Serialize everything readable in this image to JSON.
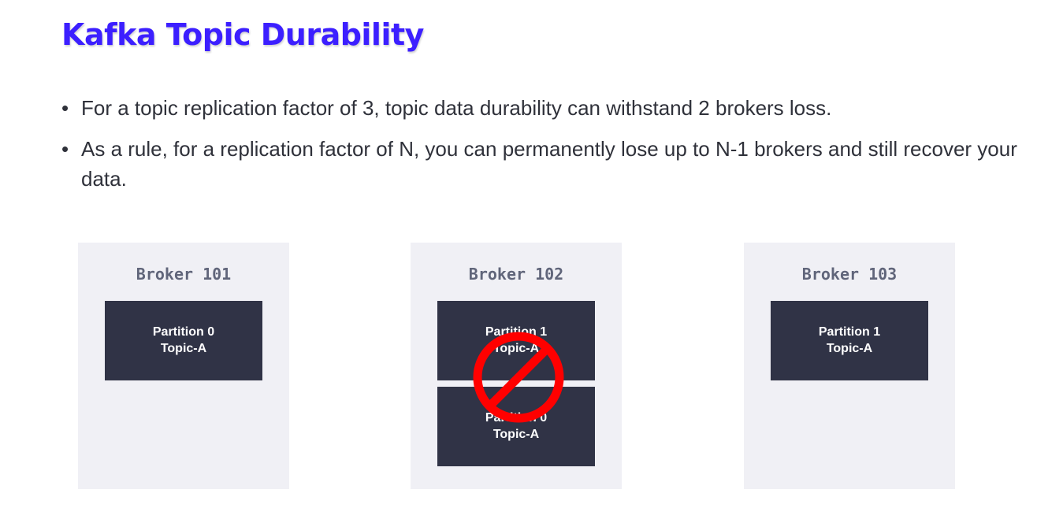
{
  "title": "Kafka Topic Durability",
  "bullets": [
    "For a topic replication factor of 3, topic data durability can withstand 2 brokers loss.",
    "As a rule, for a replication factor of N, you can permanently lose up to N-1 brokers and still recover your data."
  ],
  "brokers": [
    {
      "label": "Broker 101",
      "partitions": [
        {
          "partition": "Partition 0",
          "topic": "Topic-A"
        }
      ]
    },
    {
      "label": "Broker 102",
      "partitions": [
        {
          "partition": "Partition 1",
          "topic": "Topic-A"
        },
        {
          "partition": "Partition 0",
          "topic": "Topic-A"
        }
      ],
      "status": "lost"
    },
    {
      "label": "Broker 103",
      "partitions": [
        {
          "partition": "Partition 1",
          "topic": "Topic-A"
        }
      ]
    }
  ],
  "icons": {
    "lost_marker": "no-entry-icon"
  },
  "colors": {
    "title": "#3c1fff",
    "broker_bg": "#f0f0f5",
    "partition_bg": "#303346",
    "no_sign": "#ff0000"
  }
}
